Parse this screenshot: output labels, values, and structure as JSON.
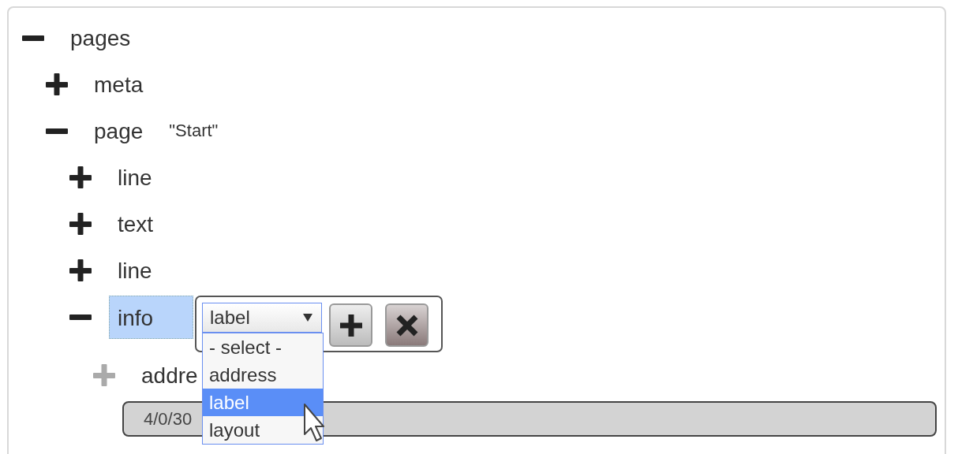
{
  "tree": [
    {
      "label": "pages",
      "expanded": true,
      "selected": false,
      "children": [
        {
          "label": "meta",
          "expanded": false,
          "selected": false
        },
        {
          "label": "page",
          "note": "\"Start\"",
          "expanded": true,
          "selected": false,
          "children": [
            {
              "label": "line",
              "expanded": false,
              "selected": false
            },
            {
              "label": "text",
              "expanded": false,
              "selected": false
            },
            {
              "label": "line",
              "expanded": false,
              "selected": false
            },
            {
              "label": "info",
              "expanded": true,
              "selected": true,
              "editor": {
                "value": "label",
                "options": [
                  {
                    "label": "- select -",
                    "selected": false
                  },
                  {
                    "label": "address",
                    "selected": false
                  },
                  {
                    "label": "label",
                    "selected": true
                  },
                  {
                    "label": "layout",
                    "selected": false
                  }
                ],
                "buttons": [
                  {
                    "kind": "add"
                  },
                  {
                    "kind": "remove"
                  }
                ]
              },
              "children": [
                {
                  "label": "addre",
                  "expanded": false,
                  "disabled": true,
                  "selected": false,
                  "value": "4/0/30"
                }
              ]
            }
          ]
        }
      ]
    }
  ]
}
